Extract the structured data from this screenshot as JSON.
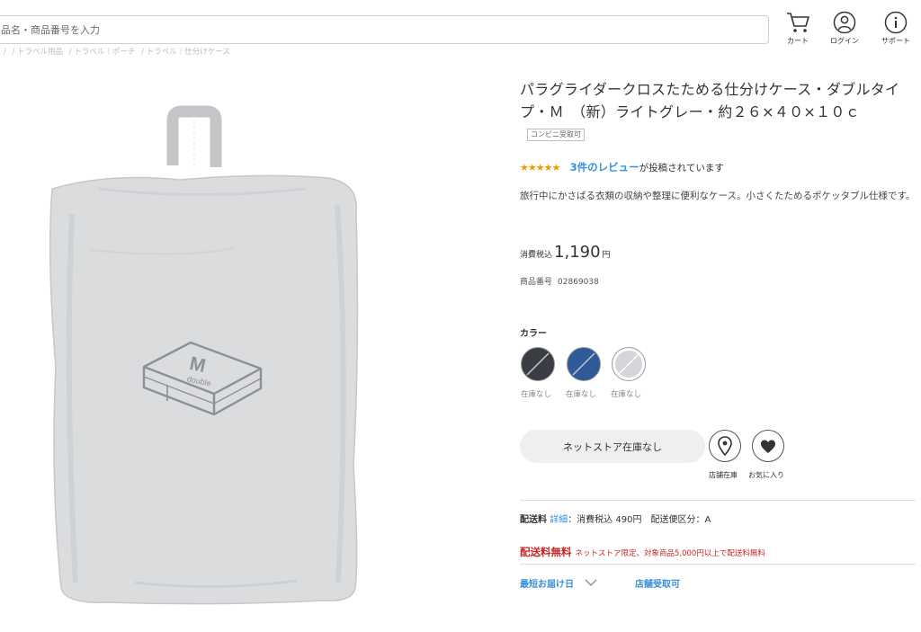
{
  "header": {
    "search_placeholder": "品名・商品番号を入力",
    "cart_label": "カート",
    "login_label": "ログイン",
    "support_label": "サポート",
    "breadcrumbs": [
      "/",
      "/ トラベル用品",
      "/ トラベル｜ポーチ",
      "/ トラベル｜仕分けケース"
    ]
  },
  "product": {
    "title": "パラグライダークロスたためる仕分けケース・ダブルタイプ・Ｍ　（新）ライトグレー・約２６×４０×１０ｃ",
    "badge": "コンビニ受取可",
    "stars": "★★★★★",
    "review_link": "3件のレビュー",
    "review_suffix": "が投稿されています",
    "description": "旅行中にかさばる衣類の収納や整理に便利なケース。小さくたためるポケッタブル仕様です。",
    "price_prefix": "消費税込",
    "price": "1,190",
    "price_unit": "円",
    "sku_label": "商品番号",
    "sku": "02869038",
    "image_text_1": "M",
    "image_text_2": "double"
  },
  "colors": {
    "label": "カラー",
    "swatches": [
      {
        "stock": "在庫なし",
        "color": "#3a3d44"
      },
      {
        "stock": "在庫なし",
        "color": "#2f5a98"
      },
      {
        "stock": "在庫なし",
        "color": "#d4d6d9"
      }
    ]
  },
  "actions": {
    "stock_button": "ネットストア在庫なし",
    "store_stock_label": "店舗在庫",
    "favorite_label": "お気に入り"
  },
  "shipping": {
    "label": "配送料",
    "detail_link": "詳細",
    "fee_text": "：消費税込 490円　配送便区分：A",
    "free_label": "配送料無料",
    "free_note": "ネットストア限定、対象商品5,000円以上で配送料無料",
    "delivery_label": "最短お届け日",
    "pickup_label": "店舗受取可"
  }
}
